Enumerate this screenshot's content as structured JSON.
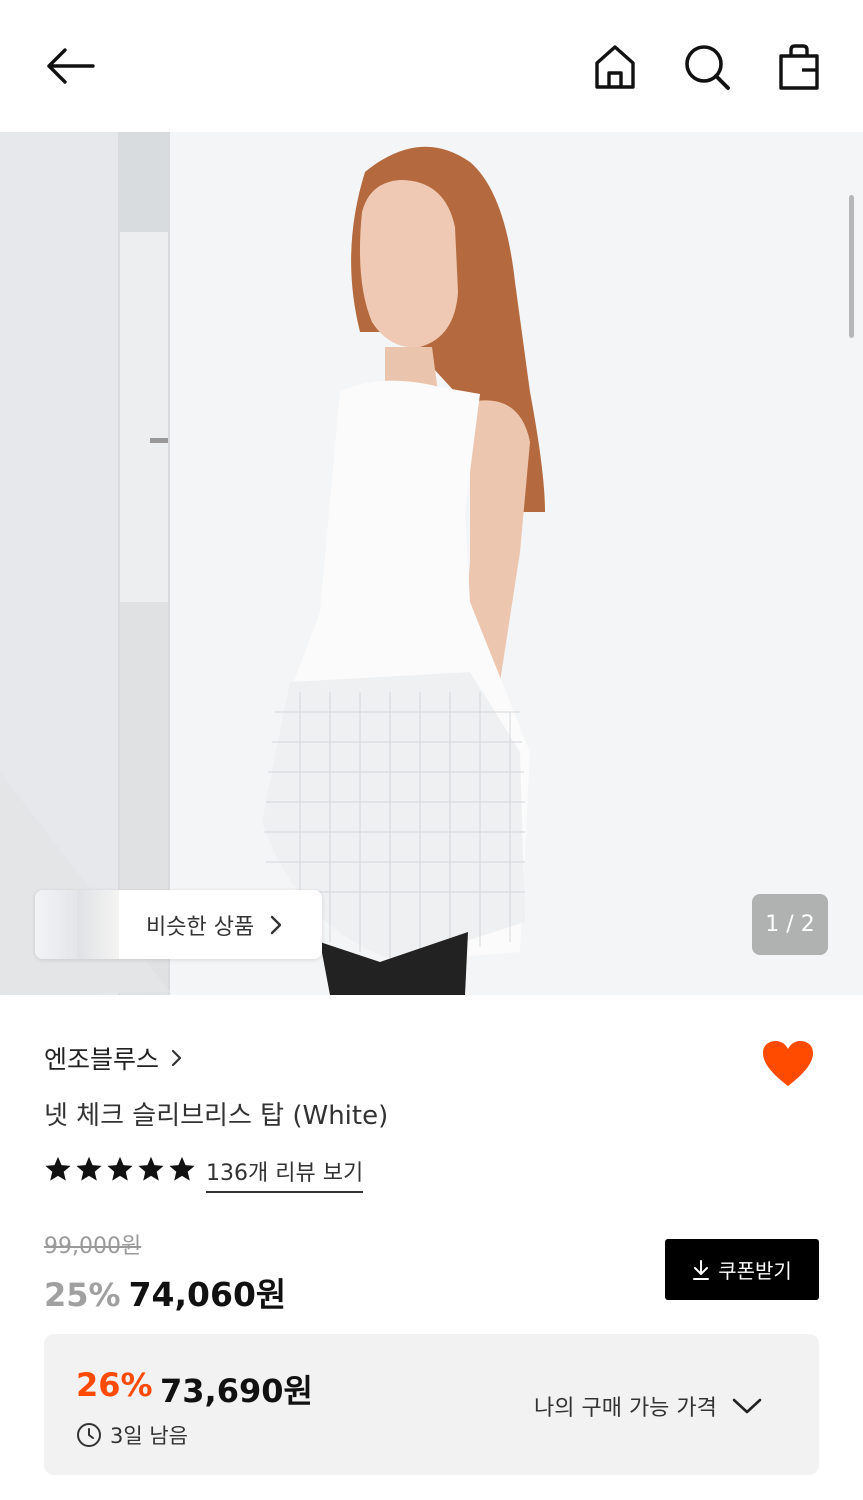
{
  "header": {
    "back_icon": "arrow-left-icon",
    "home_icon": "home-icon",
    "search_icon": "search-icon",
    "bag_icon": "shopping-bag-icon"
  },
  "gallery": {
    "similar_label": "비슷한 상품",
    "pager": "1 / 2"
  },
  "product": {
    "brand": "엔조블루스",
    "title": "넷 체크 슬리브리스 탑 (White)",
    "rating": 5,
    "review_link": "136개 리뷰 보기",
    "liked": true
  },
  "pricing": {
    "original_price": "99,000원",
    "discount_rate": "25%",
    "sale_price": "74,060원",
    "coupon_label": "쿠폰받기",
    "my_discount_rate": "26%",
    "my_price": "73,690원",
    "remaining": "3일 남음",
    "my_price_label": "나의 구매 가능 가격"
  },
  "colors": {
    "accent": "#ff4b00",
    "coupon_bg": "#000000",
    "box_bg": "#f2f2f2"
  }
}
